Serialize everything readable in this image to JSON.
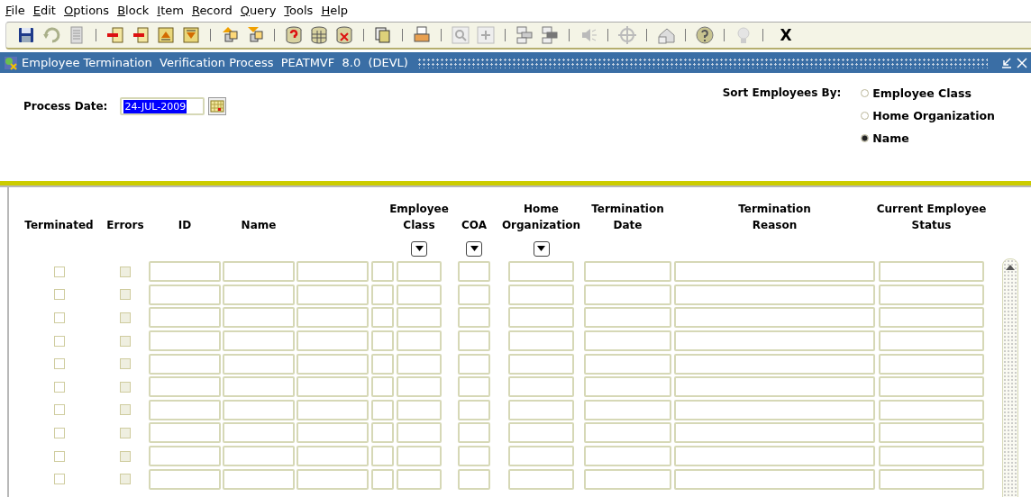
{
  "menu": [
    "File",
    "Edit",
    "Options",
    "Block",
    "Item",
    "Record",
    "Query",
    "Tools",
    "Help"
  ],
  "toolbar": {
    "exit_label": "X"
  },
  "window": {
    "title": "Employee Termination  Verification Process  PEATMVF  8.0  (DEVL)"
  },
  "process_date": {
    "label": "Process Date:",
    "value": "24-JUL-2009",
    "text_selected": true
  },
  "sort": {
    "label": "Sort Employees By:",
    "options": [
      {
        "label": "Employee Class",
        "selected": false
      },
      {
        "label": "Home Organization",
        "selected": false
      },
      {
        "label": "Name",
        "selected": true
      }
    ]
  },
  "table": {
    "columns": [
      {
        "label": "Terminated",
        "dropdown": false
      },
      {
        "label": "Errors",
        "dropdown": false
      },
      {
        "label": "ID",
        "dropdown": false
      },
      {
        "label": "Name",
        "dropdown": false
      },
      {
        "label": "Employee Class",
        "dropdown": true
      },
      {
        "label": "COA",
        "dropdown": true
      },
      {
        "label": "Home Organization",
        "dropdown": true
      },
      {
        "label": "Termination Date",
        "dropdown": false
      },
      {
        "label": "Termination Reason",
        "dropdown": false
      },
      {
        "label": "Current Employee Status",
        "dropdown": false
      }
    ],
    "rows": [
      {
        "terminated": false,
        "errors": false
      },
      {
        "terminated": false,
        "errors": false
      },
      {
        "terminated": false,
        "errors": false
      },
      {
        "terminated": false,
        "errors": false
      },
      {
        "terminated": false,
        "errors": false
      },
      {
        "terminated": false,
        "errors": false
      },
      {
        "terminated": false,
        "errors": false
      },
      {
        "terminated": false,
        "errors": false
      },
      {
        "terminated": false,
        "errors": false
      },
      {
        "terminated": false,
        "errors": false
      }
    ]
  }
}
